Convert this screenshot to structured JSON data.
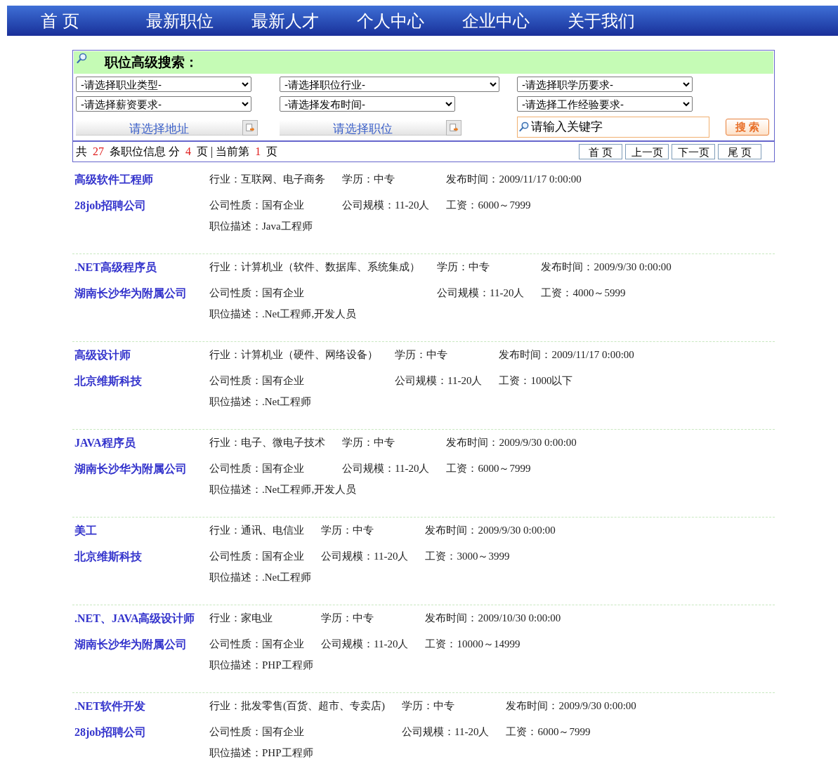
{
  "nav": [
    {
      "label": "首 页"
    },
    {
      "label": "最新职位"
    },
    {
      "label": "最新人才"
    },
    {
      "label": "个人中心"
    },
    {
      "label": "企业中心"
    },
    {
      "label": "关于我们"
    }
  ],
  "search": {
    "title": "职位高级搜索：",
    "selects": [
      {
        "value": "-请选择职业类型-"
      },
      {
        "value": "-请选择职位行业-"
      },
      {
        "value": "-请选择职学历要求-"
      },
      {
        "value": "-请选择薪资要求-"
      },
      {
        "value": "-请选择发布时间-"
      },
      {
        "value": "-请选择工作经验要求-"
      }
    ],
    "pickers": [
      {
        "label": "请选择地址"
      },
      {
        "label": "请选择职位"
      }
    ],
    "keyword": {
      "placeholder": "请输入关键字"
    },
    "button": "搜 索"
  },
  "summary": [
    {
      "kind": "text",
      "text": "共"
    },
    {
      "kind": "number",
      "text": "27"
    },
    {
      "kind": "text",
      "text": "条职位信息 分"
    },
    {
      "kind": "number",
      "text": "4"
    },
    {
      "kind": "text",
      "text": "页 | 当前第"
    },
    {
      "kind": "number",
      "text": "1"
    },
    {
      "kind": "text",
      "text": "页"
    }
  ],
  "pager": [
    "首 页",
    "上一页",
    "下一页",
    "尾 页"
  ],
  "jobs": [
    {
      "title": "高级软件工程师",
      "company": "28job招聘公司",
      "industry": "行业：互联网、电子商务",
      "education": "学历：中专",
      "published": "发布时间：2009/11/17 0:00:00",
      "nature": "公司性质：国有企业",
      "size": "公司规模：11-20人",
      "salary": "工资：6000～7999",
      "description": "职位描述：Java工程师"
    },
    {
      "title": ".NET高级程序员",
      "company": "湖南长沙华为附属公司",
      "industry": "行业：计算机业（软件、数据库、系统集成）",
      "education": "学历：中专",
      "published": "发布时间：2009/9/30 0:00:00",
      "nature": "公司性质：国有企业",
      "size": "公司规模：11-20人",
      "salary": "工资：4000～5999",
      "description": "职位描述：.Net工程师,开发人员"
    },
    {
      "title": "高级设计师",
      "company": "北京维斯科技",
      "industry": "行业：计算机业（硬件、网络设备）",
      "education": "学历：中专",
      "published": "发布时间：2009/11/17 0:00:00",
      "nature": "公司性质：国有企业",
      "size": "公司规模：11-20人",
      "salary": "工资：1000以下",
      "description": "职位描述：.Net工程师"
    },
    {
      "title": "JAVA程序员",
      "company": "湖南长沙华为附属公司",
      "industry": "行业：电子、微电子技术",
      "education": "学历：中专",
      "published": "发布时间：2009/9/30 0:00:00",
      "nature": "公司性质：国有企业",
      "size": "公司规模：11-20人",
      "salary": "工资：6000～7999",
      "description": "职位描述：.Net工程师,开发人员"
    },
    {
      "title": "美工",
      "company": "北京维斯科技",
      "industry": "行业：通讯、电信业",
      "education": "学历：中专",
      "published": "发布时间：2009/9/30 0:00:00",
      "nature": "公司性质：国有企业",
      "size": "公司规模：11-20人",
      "salary": "工资：3000～3999",
      "description": "职位描述：.Net工程师"
    },
    {
      "title": ".NET、JAVA高级设计师",
      "company": "湖南长沙华为附属公司",
      "industry": "行业：家电业",
      "education": "学历：中专",
      "published": "发布时间：2009/10/30 0:00:00",
      "nature": "公司性质：国有企业",
      "size": "公司规模：11-20人",
      "salary": "工资：10000～14999",
      "description": "职位描述：PHP工程师"
    },
    {
      "title": ".NET软件开发",
      "company": "28job招聘公司",
      "industry": "行业：批发零售(百货、超市、专卖店)",
      "education": "学历：中专",
      "published": "发布时间：2009/9/30 0:00:00",
      "nature": "公司性质：国有企业",
      "size": "公司规模：11-20人",
      "salary": "工资：6000～7999",
      "description": "职位描述：PHP工程师"
    }
  ]
}
